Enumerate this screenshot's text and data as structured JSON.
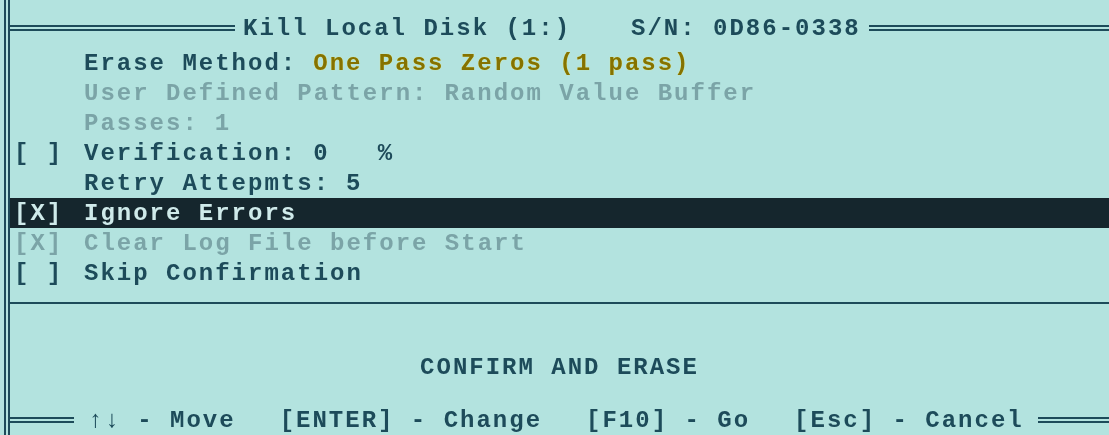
{
  "window": {
    "title": "Kill Local Disk (1:)",
    "serial": "S/N: 0D86-0338"
  },
  "options": [
    {
      "kind": "setting",
      "label": "Erase Method:",
      "value": "One Pass Zeros (1 pass)",
      "value_highlighted": true,
      "disabled": false,
      "selected": false
    },
    {
      "kind": "setting",
      "label": "User Defined Pattern:",
      "value": "Random Value Buffer",
      "value_highlighted": false,
      "disabled": true,
      "selected": false
    },
    {
      "kind": "setting",
      "label": "Passes:",
      "value": "1",
      "value_highlighted": false,
      "disabled": true,
      "selected": false
    },
    {
      "kind": "checkbox",
      "box": "[ ]",
      "label": "Verification:",
      "value": "0",
      "unit": "%",
      "value_highlighted": false,
      "disabled": false,
      "selected": false
    },
    {
      "kind": "setting",
      "label": "Retry Attepmts:",
      "value": "5",
      "value_highlighted": false,
      "disabled": false,
      "selected": false
    },
    {
      "kind": "checkbox",
      "box": "[X]",
      "label": "Ignore Errors",
      "disabled": false,
      "selected": true
    },
    {
      "kind": "checkbox",
      "box": "[X]",
      "label": "Clear Log File before Start",
      "disabled": true,
      "selected": false
    },
    {
      "kind": "checkbox",
      "box": "[ ]",
      "label": "Skip Confirmation",
      "disabled": false,
      "selected": false
    }
  ],
  "confirm_button": "CONFIRM AND ERASE",
  "footer": [
    {
      "label": "↑↓ - Move"
    },
    {
      "label": "[ENTER] - Change"
    },
    {
      "label": "[F10] - Go"
    },
    {
      "label": "[Esc] - Cancel"
    }
  ]
}
